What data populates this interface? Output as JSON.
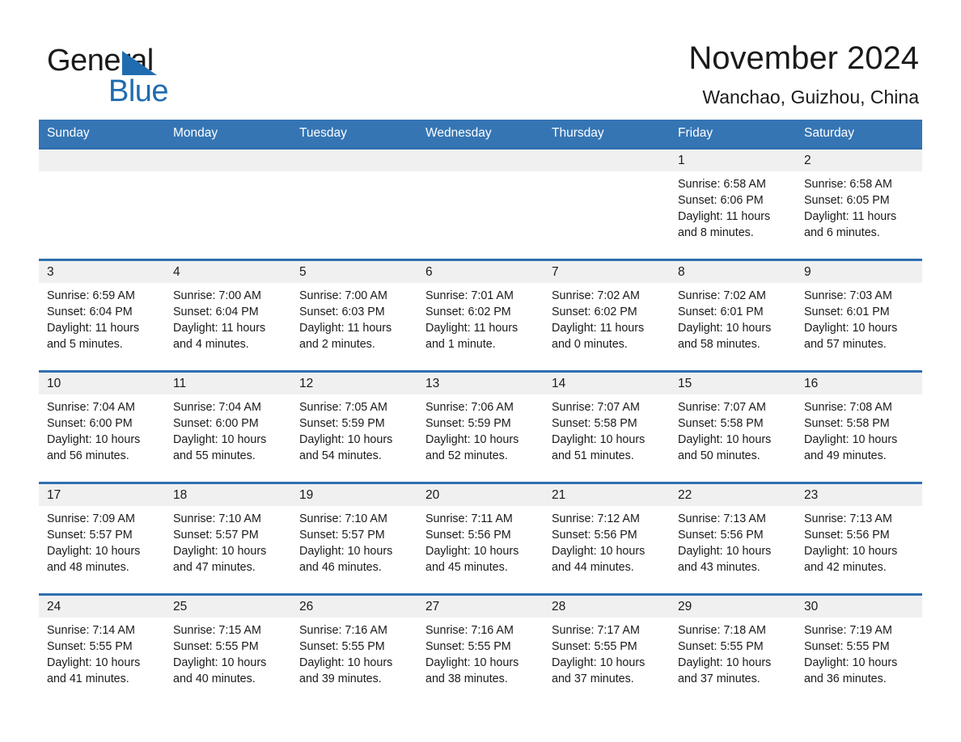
{
  "brand": {
    "name_part1": "General",
    "name_part2": "Blue",
    "triangle_color": "#1f6cb0"
  },
  "header": {
    "title": "November 2024",
    "subtitle": "Wanchao, Guizhou, China"
  },
  "colors": {
    "header_blue": "#3575b4",
    "row_rule_blue": "#2f6fb0",
    "date_strip_gray": "#f0f0f0"
  },
  "weekdays": [
    "Sunday",
    "Monday",
    "Tuesday",
    "Wednesday",
    "Thursday",
    "Friday",
    "Saturday"
  ],
  "weeks": [
    [
      {
        "day": "",
        "empty": true,
        "sunrise": "",
        "sunset": "",
        "daylight1": "",
        "daylight2": ""
      },
      {
        "day": "",
        "empty": true,
        "sunrise": "",
        "sunset": "",
        "daylight1": "",
        "daylight2": ""
      },
      {
        "day": "",
        "empty": true,
        "sunrise": "",
        "sunset": "",
        "daylight1": "",
        "daylight2": ""
      },
      {
        "day": "",
        "empty": true,
        "sunrise": "",
        "sunset": "",
        "daylight1": "",
        "daylight2": ""
      },
      {
        "day": "",
        "empty": true,
        "sunrise": "",
        "sunset": "",
        "daylight1": "",
        "daylight2": ""
      },
      {
        "day": "1",
        "empty": false,
        "sunrise": "Sunrise: 6:58 AM",
        "sunset": "Sunset: 6:06 PM",
        "daylight1": "Daylight: 11 hours",
        "daylight2": "and 8 minutes."
      },
      {
        "day": "2",
        "empty": false,
        "sunrise": "Sunrise: 6:58 AM",
        "sunset": "Sunset: 6:05 PM",
        "daylight1": "Daylight: 11 hours",
        "daylight2": "and 6 minutes."
      }
    ],
    [
      {
        "day": "3",
        "empty": false,
        "sunrise": "Sunrise: 6:59 AM",
        "sunset": "Sunset: 6:04 PM",
        "daylight1": "Daylight: 11 hours",
        "daylight2": "and 5 minutes."
      },
      {
        "day": "4",
        "empty": false,
        "sunrise": "Sunrise: 7:00 AM",
        "sunset": "Sunset: 6:04 PM",
        "daylight1": "Daylight: 11 hours",
        "daylight2": "and 4 minutes."
      },
      {
        "day": "5",
        "empty": false,
        "sunrise": "Sunrise: 7:00 AM",
        "sunset": "Sunset: 6:03 PM",
        "daylight1": "Daylight: 11 hours",
        "daylight2": "and 2 minutes."
      },
      {
        "day": "6",
        "empty": false,
        "sunrise": "Sunrise: 7:01 AM",
        "sunset": "Sunset: 6:02 PM",
        "daylight1": "Daylight: 11 hours",
        "daylight2": "and 1 minute."
      },
      {
        "day": "7",
        "empty": false,
        "sunrise": "Sunrise: 7:02 AM",
        "sunset": "Sunset: 6:02 PM",
        "daylight1": "Daylight: 11 hours",
        "daylight2": "and 0 minutes."
      },
      {
        "day": "8",
        "empty": false,
        "sunrise": "Sunrise: 7:02 AM",
        "sunset": "Sunset: 6:01 PM",
        "daylight1": "Daylight: 10 hours",
        "daylight2": "and 58 minutes."
      },
      {
        "day": "9",
        "empty": false,
        "sunrise": "Sunrise: 7:03 AM",
        "sunset": "Sunset: 6:01 PM",
        "daylight1": "Daylight: 10 hours",
        "daylight2": "and 57 minutes."
      }
    ],
    [
      {
        "day": "10",
        "empty": false,
        "sunrise": "Sunrise: 7:04 AM",
        "sunset": "Sunset: 6:00 PM",
        "daylight1": "Daylight: 10 hours",
        "daylight2": "and 56 minutes."
      },
      {
        "day": "11",
        "empty": false,
        "sunrise": "Sunrise: 7:04 AM",
        "sunset": "Sunset: 6:00 PM",
        "daylight1": "Daylight: 10 hours",
        "daylight2": "and 55 minutes."
      },
      {
        "day": "12",
        "empty": false,
        "sunrise": "Sunrise: 7:05 AM",
        "sunset": "Sunset: 5:59 PM",
        "daylight1": "Daylight: 10 hours",
        "daylight2": "and 54 minutes."
      },
      {
        "day": "13",
        "empty": false,
        "sunrise": "Sunrise: 7:06 AM",
        "sunset": "Sunset: 5:59 PM",
        "daylight1": "Daylight: 10 hours",
        "daylight2": "and 52 minutes."
      },
      {
        "day": "14",
        "empty": false,
        "sunrise": "Sunrise: 7:07 AM",
        "sunset": "Sunset: 5:58 PM",
        "daylight1": "Daylight: 10 hours",
        "daylight2": "and 51 minutes."
      },
      {
        "day": "15",
        "empty": false,
        "sunrise": "Sunrise: 7:07 AM",
        "sunset": "Sunset: 5:58 PM",
        "daylight1": "Daylight: 10 hours",
        "daylight2": "and 50 minutes."
      },
      {
        "day": "16",
        "empty": false,
        "sunrise": "Sunrise: 7:08 AM",
        "sunset": "Sunset: 5:58 PM",
        "daylight1": "Daylight: 10 hours",
        "daylight2": "and 49 minutes."
      }
    ],
    [
      {
        "day": "17",
        "empty": false,
        "sunrise": "Sunrise: 7:09 AM",
        "sunset": "Sunset: 5:57 PM",
        "daylight1": "Daylight: 10 hours",
        "daylight2": "and 48 minutes."
      },
      {
        "day": "18",
        "empty": false,
        "sunrise": "Sunrise: 7:10 AM",
        "sunset": "Sunset: 5:57 PM",
        "daylight1": "Daylight: 10 hours",
        "daylight2": "and 47 minutes."
      },
      {
        "day": "19",
        "empty": false,
        "sunrise": "Sunrise: 7:10 AM",
        "sunset": "Sunset: 5:57 PM",
        "daylight1": "Daylight: 10 hours",
        "daylight2": "and 46 minutes."
      },
      {
        "day": "20",
        "empty": false,
        "sunrise": "Sunrise: 7:11 AM",
        "sunset": "Sunset: 5:56 PM",
        "daylight1": "Daylight: 10 hours",
        "daylight2": "and 45 minutes."
      },
      {
        "day": "21",
        "empty": false,
        "sunrise": "Sunrise: 7:12 AM",
        "sunset": "Sunset: 5:56 PM",
        "daylight1": "Daylight: 10 hours",
        "daylight2": "and 44 minutes."
      },
      {
        "day": "22",
        "empty": false,
        "sunrise": "Sunrise: 7:13 AM",
        "sunset": "Sunset: 5:56 PM",
        "daylight1": "Daylight: 10 hours",
        "daylight2": "and 43 minutes."
      },
      {
        "day": "23",
        "empty": false,
        "sunrise": "Sunrise: 7:13 AM",
        "sunset": "Sunset: 5:56 PM",
        "daylight1": "Daylight: 10 hours",
        "daylight2": "and 42 minutes."
      }
    ],
    [
      {
        "day": "24",
        "empty": false,
        "sunrise": "Sunrise: 7:14 AM",
        "sunset": "Sunset: 5:55 PM",
        "daylight1": "Daylight: 10 hours",
        "daylight2": "and 41 minutes."
      },
      {
        "day": "25",
        "empty": false,
        "sunrise": "Sunrise: 7:15 AM",
        "sunset": "Sunset: 5:55 PM",
        "daylight1": "Daylight: 10 hours",
        "daylight2": "and 40 minutes."
      },
      {
        "day": "26",
        "empty": false,
        "sunrise": "Sunrise: 7:16 AM",
        "sunset": "Sunset: 5:55 PM",
        "daylight1": "Daylight: 10 hours",
        "daylight2": "and 39 minutes."
      },
      {
        "day": "27",
        "empty": false,
        "sunrise": "Sunrise: 7:16 AM",
        "sunset": "Sunset: 5:55 PM",
        "daylight1": "Daylight: 10 hours",
        "daylight2": "and 38 minutes."
      },
      {
        "day": "28",
        "empty": false,
        "sunrise": "Sunrise: 7:17 AM",
        "sunset": "Sunset: 5:55 PM",
        "daylight1": "Daylight: 10 hours",
        "daylight2": "and 37 minutes."
      },
      {
        "day": "29",
        "empty": false,
        "sunrise": "Sunrise: 7:18 AM",
        "sunset": "Sunset: 5:55 PM",
        "daylight1": "Daylight: 10 hours",
        "daylight2": "and 37 minutes."
      },
      {
        "day": "30",
        "empty": false,
        "sunrise": "Sunrise: 7:19 AM",
        "sunset": "Sunset: 5:55 PM",
        "daylight1": "Daylight: 10 hours",
        "daylight2": "and 36 minutes."
      }
    ]
  ]
}
